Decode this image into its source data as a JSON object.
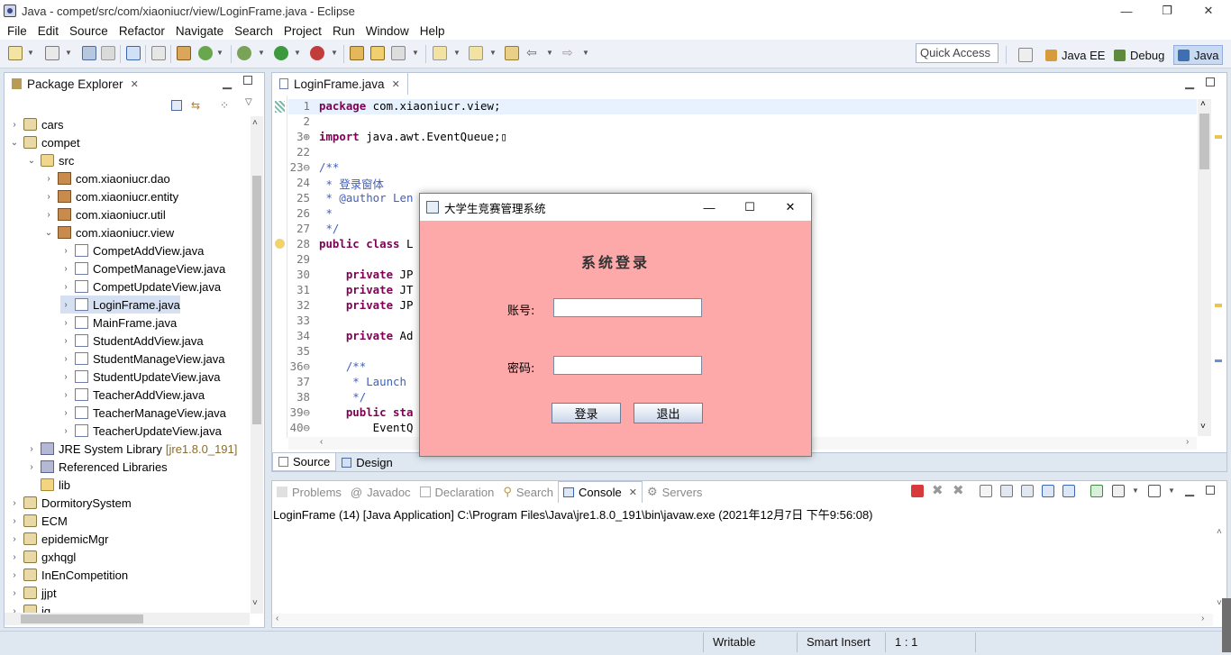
{
  "window": {
    "title": "Java - compet/src/com/xiaoniucr/view/LoginFrame.java - Eclipse",
    "min": "—",
    "restore": "❐",
    "close": "✕"
  },
  "menu": [
    "File",
    "Edit",
    "Source",
    "Refactor",
    "Navigate",
    "Search",
    "Project",
    "Run",
    "Window",
    "Help"
  ],
  "quick_access": "Quick Access",
  "perspectives": [
    {
      "label": "Java EE",
      "color": "#d69c3b"
    },
    {
      "label": "Debug",
      "color": "#5f8a3c"
    },
    {
      "label": "Java",
      "color": "#3f6fb3"
    }
  ],
  "explorer": {
    "title": "Package Explorer",
    "close": "✕",
    "rows": [
      {
        "indent": 0,
        "tw": "›",
        "icon": "proj",
        "label": "cars"
      },
      {
        "indent": 0,
        "tw": "⌄",
        "icon": "proj",
        "label": "compet"
      },
      {
        "indent": 1,
        "tw": "⌄",
        "icon": "src",
        "label": "src"
      },
      {
        "indent": 2,
        "tw": "›",
        "icon": "pkg",
        "label": "com.xiaoniucr.dao"
      },
      {
        "indent": 2,
        "tw": "›",
        "icon": "pkg",
        "label": "com.xiaoniucr.entity"
      },
      {
        "indent": 2,
        "tw": "›",
        "icon": "pkg",
        "label": "com.xiaoniucr.util"
      },
      {
        "indent": 2,
        "tw": "⌄",
        "icon": "pkg",
        "label": "com.xiaoniucr.view"
      },
      {
        "indent": 3,
        "tw": "›",
        "icon": "java",
        "label": "CompetAddView.java"
      },
      {
        "indent": 3,
        "tw": "›",
        "icon": "java",
        "label": "CompetManageView.java"
      },
      {
        "indent": 3,
        "tw": "›",
        "icon": "java",
        "label": "CompetUpdateView.java"
      },
      {
        "indent": 3,
        "tw": "›",
        "icon": "java",
        "label": "LoginFrame.java",
        "selected": true
      },
      {
        "indent": 3,
        "tw": "›",
        "icon": "java",
        "label": "MainFrame.java"
      },
      {
        "indent": 3,
        "tw": "›",
        "icon": "java",
        "label": "StudentAddView.java"
      },
      {
        "indent": 3,
        "tw": "›",
        "icon": "java",
        "label": "StudentManageView.java"
      },
      {
        "indent": 3,
        "tw": "›",
        "icon": "java",
        "label": "StudentUpdateView.java"
      },
      {
        "indent": 3,
        "tw": "›",
        "icon": "java",
        "label": "TeacherAddView.java"
      },
      {
        "indent": 3,
        "tw": "›",
        "icon": "java",
        "label": "TeacherManageView.java"
      },
      {
        "indent": 3,
        "tw": "›",
        "icon": "java",
        "label": "TeacherUpdateView.java"
      },
      {
        "indent": 1,
        "tw": "›",
        "icon": "lib",
        "label": "JRE System Library",
        "extra": "[jre1.8.0_191]"
      },
      {
        "indent": 1,
        "tw": "›",
        "icon": "lib",
        "label": "Referenced Libraries"
      },
      {
        "indent": 1,
        "tw": "",
        "icon": "fold",
        "label": "lib"
      },
      {
        "indent": 0,
        "tw": "›",
        "icon": "proj",
        "label": "DormitorySystem"
      },
      {
        "indent": 0,
        "tw": "›",
        "icon": "proj",
        "label": "ECM"
      },
      {
        "indent": 0,
        "tw": "›",
        "icon": "proj",
        "label": "epidemicMgr"
      },
      {
        "indent": 0,
        "tw": "›",
        "icon": "proj",
        "label": "gxhqgl"
      },
      {
        "indent": 0,
        "tw": "›",
        "icon": "proj",
        "label": "InEnCompetition"
      },
      {
        "indent": 0,
        "tw": "›",
        "icon": "proj",
        "label": "jjpt"
      },
      {
        "indent": 0,
        "tw": "›",
        "icon": "proj",
        "label": "jq"
      }
    ]
  },
  "editor": {
    "tab": "LoginFrame.java",
    "close": "✕",
    "lines": [
      {
        "n": "1",
        "parts": [
          [
            "kw",
            "package"
          ],
          [
            "plain",
            " com.xiaoniucr.view;"
          ]
        ],
        "hl": true
      },
      {
        "n": "2",
        "parts": []
      },
      {
        "n": "3⊕",
        "parts": [
          [
            "kw",
            "import"
          ],
          [
            "plain",
            " java.awt.EventQueue;"
          ],
          [
            "plain",
            "▯"
          ]
        ]
      },
      {
        "n": "22",
        "parts": []
      },
      {
        "n": "23⊖",
        "parts": [
          [
            "cm",
            "/**"
          ]
        ]
      },
      {
        "n": "24",
        "parts": [
          [
            "cm",
            " * 登录窗体"
          ]
        ]
      },
      {
        "n": "25",
        "parts": [
          [
            "cm",
            " * @author Len"
          ]
        ]
      },
      {
        "n": "26",
        "parts": [
          [
            "cm",
            " *"
          ]
        ]
      },
      {
        "n": "27",
        "parts": [
          [
            "cm",
            " */"
          ]
        ]
      },
      {
        "n": "28",
        "parts": [
          [
            "kw",
            "public class"
          ],
          [
            "plain",
            " L"
          ]
        ]
      },
      {
        "n": "29",
        "parts": []
      },
      {
        "n": "30",
        "parts": [
          [
            "plain",
            "    "
          ],
          [
            "kw",
            "private"
          ],
          [
            "plain",
            " JP"
          ]
        ]
      },
      {
        "n": "31",
        "parts": [
          [
            "plain",
            "    "
          ],
          [
            "kw",
            "private"
          ],
          [
            "plain",
            " JT"
          ]
        ]
      },
      {
        "n": "32",
        "parts": [
          [
            "plain",
            "    "
          ],
          [
            "kw",
            "private"
          ],
          [
            "plain",
            " JP"
          ]
        ]
      },
      {
        "n": "33",
        "parts": []
      },
      {
        "n": "34",
        "parts": [
          [
            "plain",
            "    "
          ],
          [
            "kw",
            "private"
          ],
          [
            "plain",
            " Ad"
          ]
        ]
      },
      {
        "n": "35",
        "parts": []
      },
      {
        "n": "36⊖",
        "parts": [
          [
            "plain",
            "    "
          ],
          [
            "cm",
            "/**"
          ]
        ]
      },
      {
        "n": "37",
        "parts": [
          [
            "cm",
            "     * Launch"
          ]
        ]
      },
      {
        "n": "38",
        "parts": [
          [
            "cm",
            "     */"
          ]
        ]
      },
      {
        "n": "39⊖",
        "parts": [
          [
            "plain",
            "    "
          ],
          [
            "kw",
            "public sta"
          ]
        ]
      },
      {
        "n": "40⊖",
        "parts": [
          [
            "plain",
            "        EventQ"
          ]
        ]
      }
    ],
    "bottom_tabs": [
      "Source",
      "Design"
    ]
  },
  "console": {
    "tabs": [
      "Problems",
      "Javadoc",
      "Declaration",
      "Search",
      "Console",
      "Servers"
    ],
    "active": "Console",
    "header": "LoginFrame (14) [Java Application] C:\\Program Files\\Java\\jre1.8.0_191\\bin\\javaw.exe (2021年12月7日 下午9:56:08)"
  },
  "status": {
    "writable": "Writable",
    "insert": "Smart Insert",
    "pos": "1 : 1"
  },
  "dialog": {
    "title": "大学生竞赛管理系统",
    "heading": "系统登录",
    "account_label": "账号:",
    "password_label": "密码:",
    "account_value": "",
    "password_value": "",
    "login": "登录",
    "exit": "退出",
    "min": "—",
    "max": "☐",
    "close": "✕",
    "bg": "#fea9a9"
  }
}
